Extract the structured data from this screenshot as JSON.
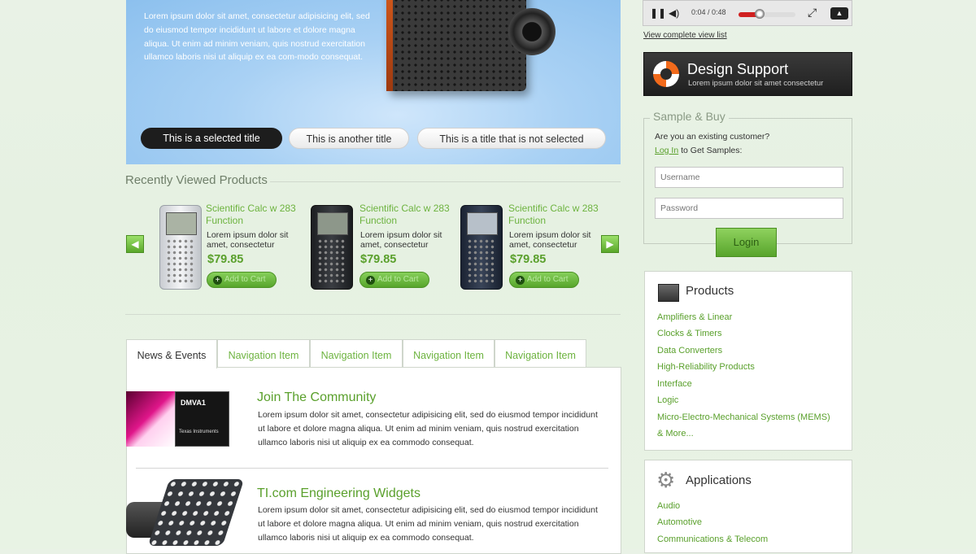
{
  "hero": {
    "text": "Lorem ipsum dolor sit amet, consectetur adipisicing elit, sed do eiusmod tempor incididunt ut labore et dolore magna aliqua. Ut enim ad minim veniam, quis nostrud exercitation ullamco laboris nisi ut aliquip ex ea com-modo consequat.",
    "tabs": [
      {
        "label": "This is a selected title",
        "selected": true
      },
      {
        "label": "This is another title",
        "selected": false
      },
      {
        "label": "This is a title that is not selected",
        "selected": false
      }
    ]
  },
  "recently_viewed": {
    "title": "Recently Viewed Products",
    "products": [
      {
        "name": "Scientific Calc w 283 Function",
        "desc": "Lorem ipsum dolor sit amet, consectetur",
        "price": "$79.85",
        "cart": "Add to Cart"
      },
      {
        "name": "Scientific Calc w 283 Function",
        "desc": "Lorem ipsum dolor sit amet, consectetur",
        "price": "$79.85",
        "cart": "Add to Cart"
      },
      {
        "name": "Scientific Calc w 283 Function",
        "desc": "Lorem ipsum dolor sit amet, consectetur",
        "price": "$79.85",
        "cart": "Add to Cart"
      }
    ]
  },
  "tabs": [
    {
      "label": "News & Events",
      "active": true
    },
    {
      "label": "Navigation Item",
      "active": false
    },
    {
      "label": "Navigation Item",
      "active": false
    },
    {
      "label": "Navigation Item",
      "active": false
    },
    {
      "label": "Navigation Item",
      "active": false
    }
  ],
  "news": [
    {
      "title": "Join The Community",
      "text": "Lorem ipsum dolor sit amet, consectetur adipisicing elit, sed do eiusmod tempor incididunt ut labore et dolore magna aliqua. Ut enim ad  minim veniam, quis nostrud exercitation ullamco laboris nisi ut aliquip ex ea commodo consequat.",
      "chip_label": "DMVA1",
      "chip_brand": "Texas Instruments"
    },
    {
      "title": "TI.com Engineering Widgets",
      "text": "Lorem ipsum dolor sit amet, consectetur adipisicing elit, sed do eiusmod tempor incididunt ut labore et dolore magna aliqua. Ut enim ad  minim veniam, quis nostrud exercitation ullamco laboris nisi ut aliquip ex ea commodo consequat."
    }
  ],
  "player": {
    "time": "0:04 / 0:48",
    "progress": 0.35
  },
  "view_list_link": "View complete view list",
  "design_support": {
    "title": "Design Support",
    "subtitle": "Lorem ipsum dolor sit amet consectetur"
  },
  "sample_buy": {
    "legend": "Sample & Buy",
    "line1": "Are you an existing customer?",
    "login_link": "Log In",
    "line2": " to Get Samples:",
    "username_placeholder": "Username",
    "password_placeholder": "Password",
    "login_button": "Login"
  },
  "products_card": {
    "title": "Products",
    "links": [
      "Amplifiers & Linear",
      "Clocks & Timers",
      "Data Converters",
      "High-Reliability Products",
      "Interface",
      "Logic",
      "Micro-Electro-Mechanical Systems (MEMS)",
      "& More..."
    ]
  },
  "applications_card": {
    "title": "Applications",
    "links": [
      "Audio",
      "Automotive",
      "Communications & Telecom"
    ]
  },
  "colors": {
    "accent_green": "#5aa02c",
    "dark": "#1d1d1d",
    "orange": "#f26a1b"
  }
}
